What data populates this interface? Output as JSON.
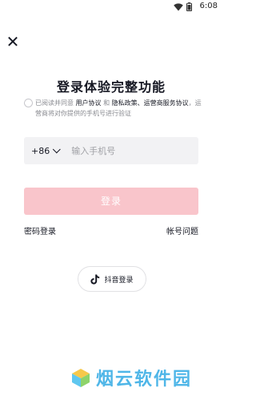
{
  "status_bar": {
    "time": "6:08",
    "icons": [
      "wifi-icon",
      "battery-icon"
    ]
  },
  "header": {
    "close_icon": "close-icon",
    "close_glyph": "✕"
  },
  "title": "登录体验完整功能",
  "agreement": {
    "prefix": "已阅读并同意",
    "user_agreement": "用户协议",
    "and": "和",
    "privacy_policy": "隐私政策、运营商服务协议",
    "suffix": "，运营商将对你提供的手机号进行验证"
  },
  "phone": {
    "country_code": "+86",
    "placeholder": "输入手机号",
    "value": ""
  },
  "login_button": {
    "label": "登录",
    "color": "#f9c5cb"
  },
  "links": {
    "password_login": "密码登录",
    "account_issue": "帐号问题"
  },
  "tiktok_login": {
    "label": "抖音登录",
    "icon": "tiktok-icon"
  },
  "watermark": {
    "text": "烟云软件园",
    "color": "#4fb6e8"
  }
}
